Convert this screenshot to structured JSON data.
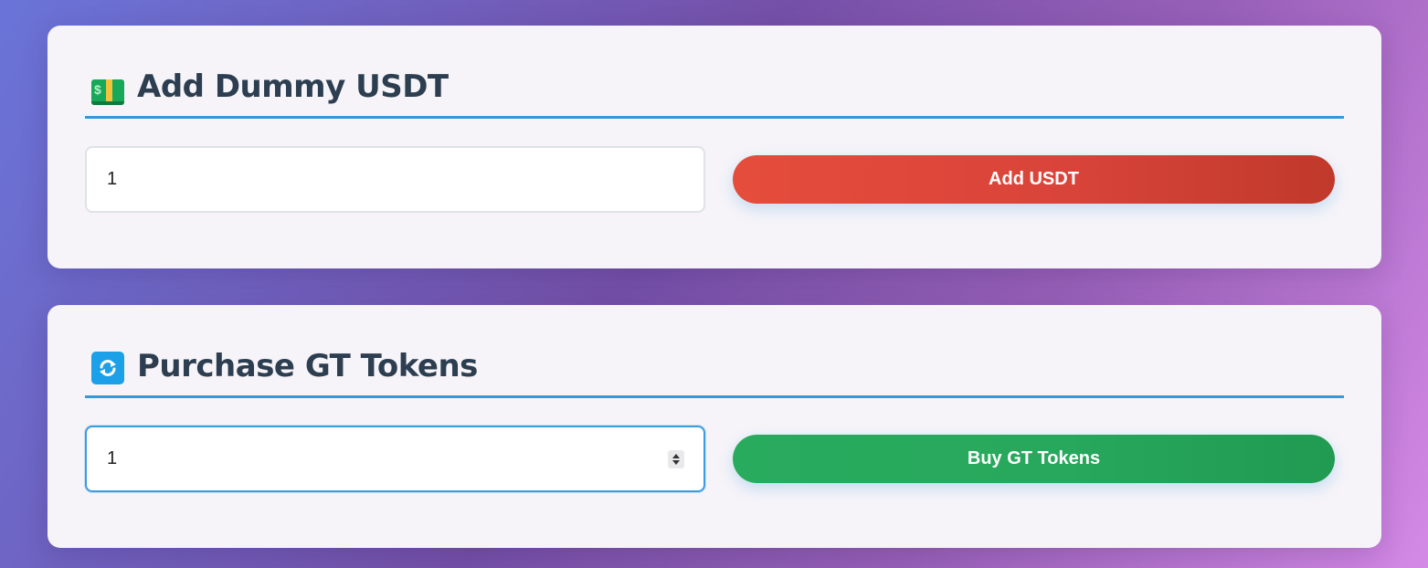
{
  "add_usdt": {
    "icon": "money-icon",
    "title": "Add Dummy USDT",
    "input_value": "1",
    "button_label": "Add USDT",
    "button_color": "#e74c3c"
  },
  "purchase_gt": {
    "icon": "refresh-icon",
    "title": "Purchase GT Tokens",
    "input_value": "1",
    "button_label": "Buy GT Tokens",
    "button_color": "#27ae60"
  },
  "colors": {
    "title_text": "#2c3e50",
    "divider": "#3498db",
    "card_background": "#f6f4f9"
  }
}
